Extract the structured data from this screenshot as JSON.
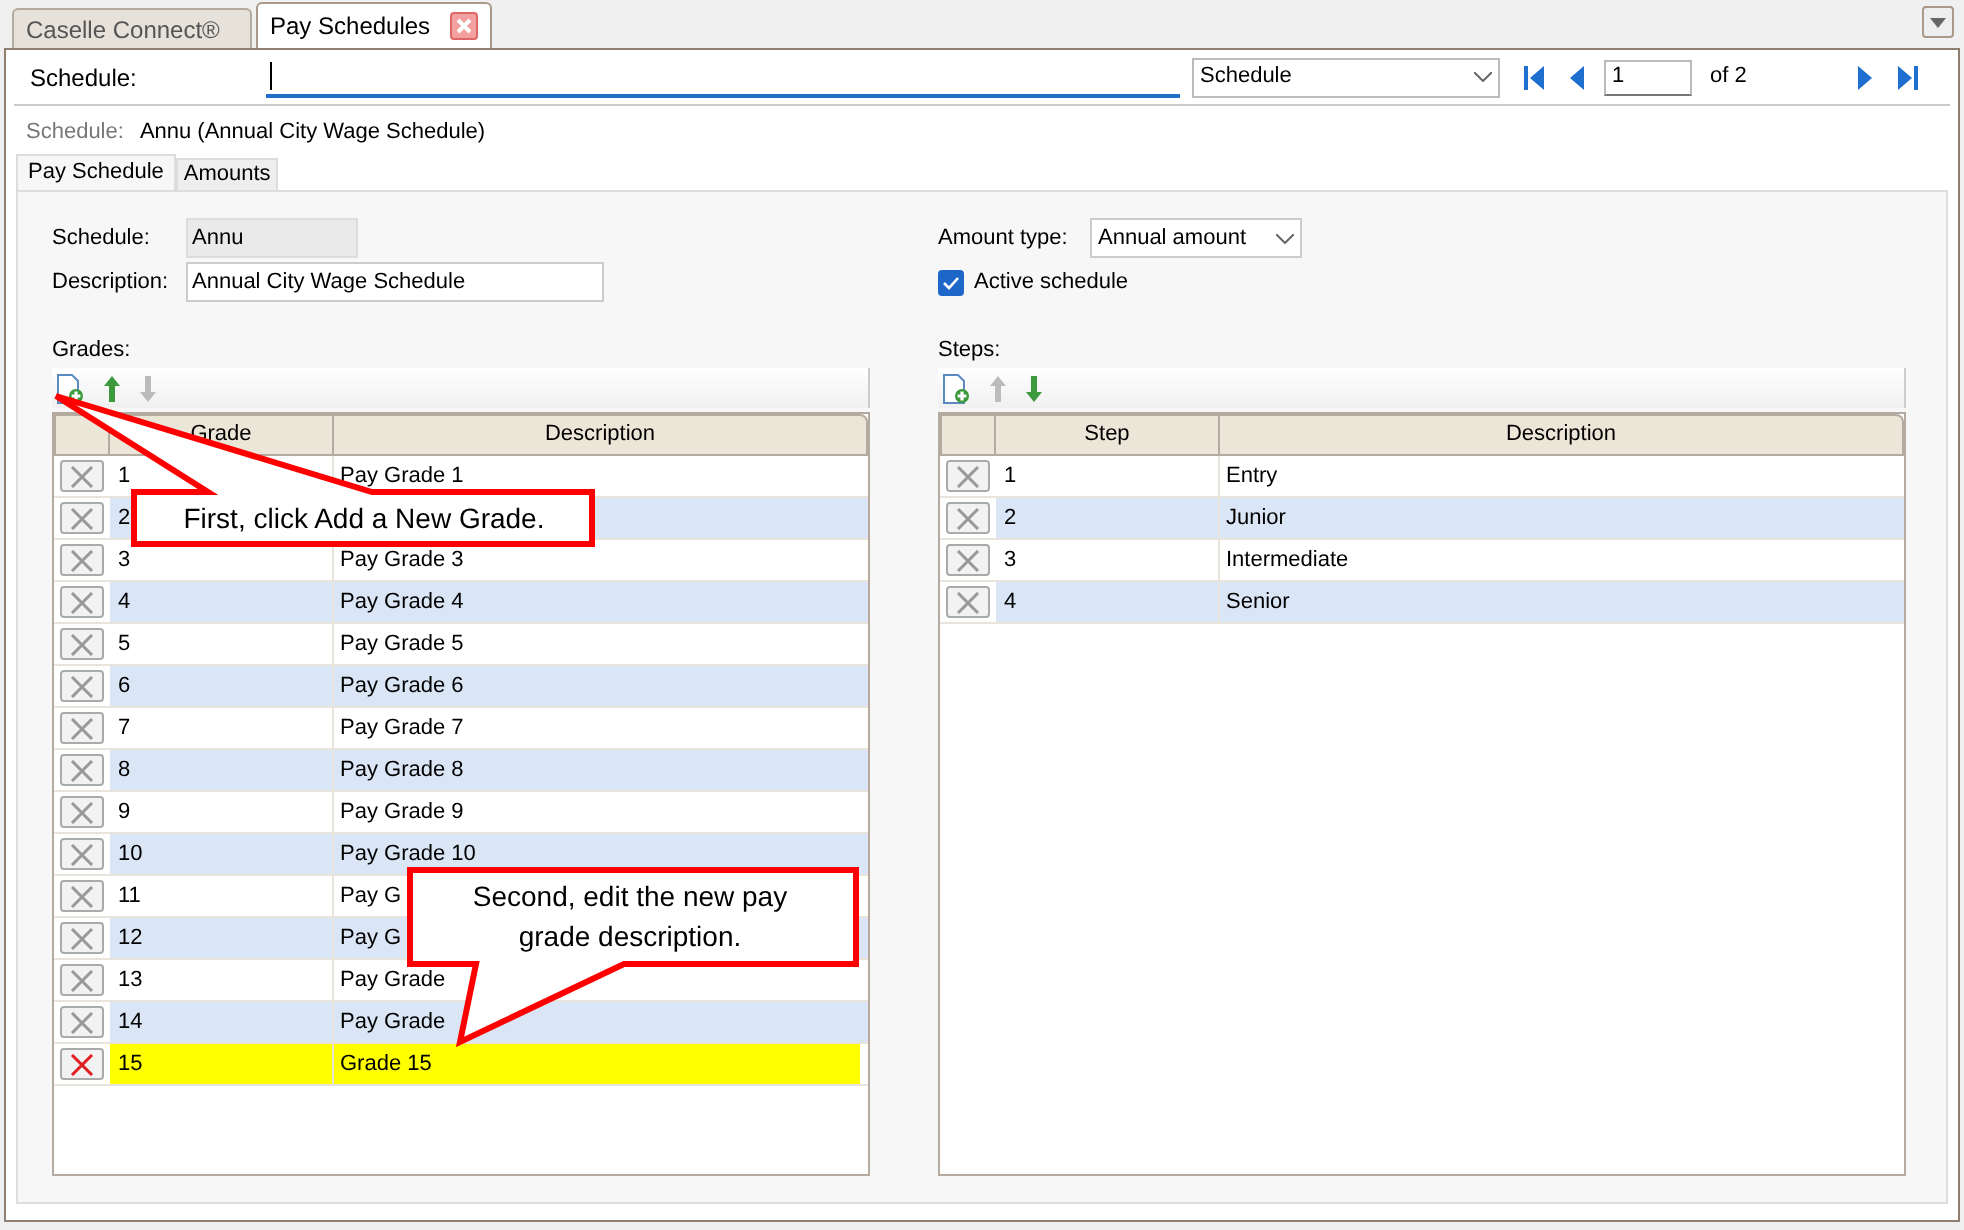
{
  "tabs": [
    {
      "label": "Caselle Connect®",
      "selected": false,
      "closable": false
    },
    {
      "label": "Pay Schedules",
      "selected": true,
      "closable": true
    }
  ],
  "search": {
    "label": "Schedule:",
    "lookup": "Schedule",
    "page": "1",
    "page_of": "of 2"
  },
  "current": {
    "label": "Schedule:",
    "value": "Annu (Annual City Wage Schedule)"
  },
  "subtabs": [
    {
      "label": "Pay Schedule",
      "selected": true
    },
    {
      "label": "Amounts",
      "selected": false
    }
  ],
  "form": {
    "schedule": {
      "label": "Schedule:",
      "value": "Annu"
    },
    "description": {
      "label": "Description:",
      "value": "Annual City Wage Schedule"
    },
    "amount_type": {
      "label": "Amount type:",
      "value": "Annual amount"
    },
    "active": {
      "label": "Active schedule",
      "checked": true
    }
  },
  "grids": [
    {
      "title": "Grades:",
      "up_disabled": false,
      "down_disabled": true,
      "columns": [
        "Grade",
        "Description"
      ],
      "rows": [
        {
          "number": "1",
          "description": "Pay Grade 1",
          "selected": false
        },
        {
          "number": "2",
          "selected": false
        },
        {
          "number": "3",
          "description": "Pay Grade 3",
          "selected": false
        },
        {
          "number": "4",
          "description": "Pay Grade 4",
          "selected": false
        },
        {
          "number": "5",
          "description": "Pay Grade 5",
          "selected": false
        },
        {
          "number": "6",
          "description": "Pay Grade 6",
          "selected": false
        },
        {
          "number": "7",
          "description": "Pay Grade 7",
          "selected": false
        },
        {
          "number": "8",
          "description": "Pay Grade 8",
          "selected": false
        },
        {
          "number": "9",
          "description": "Pay Grade 9",
          "selected": false
        },
        {
          "number": "10",
          "description": "Pay Grade 10",
          "selected": false
        },
        {
          "number": "11",
          "description": "Pay G",
          "selected": false
        },
        {
          "number": "12",
          "description": "Pay G",
          "selected": false
        },
        {
          "number": "13",
          "description": "Pay Grade",
          "selected": false
        },
        {
          "number": "14",
          "description": "Pay Grade",
          "selected": false
        },
        {
          "number": "15",
          "description": "Grade 15",
          "selected": true
        }
      ]
    },
    {
      "title": "Steps:",
      "up_disabled": true,
      "down_disabled": false,
      "columns": [
        "Step",
        "Description"
      ],
      "rows": [
        {
          "number": "1",
          "description": "Entry",
          "selected": false
        },
        {
          "number": "2",
          "description": "Junior",
          "selected": false
        },
        {
          "number": "3",
          "description": "Intermediate",
          "selected": false
        },
        {
          "number": "4",
          "description": "Senior",
          "selected": false
        }
      ]
    }
  ],
  "callouts": [
    {
      "text": "First, click Add a New Grade."
    },
    {
      "text": "Second, edit the new pay grade description."
    }
  ]
}
